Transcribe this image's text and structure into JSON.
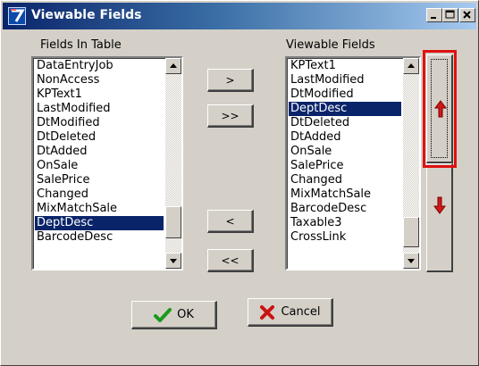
{
  "window": {
    "title": "Viewable Fields",
    "controls": [
      "minimize",
      "maximize",
      "close"
    ]
  },
  "left_panel": {
    "label": "Fields In Table",
    "items": [
      "DataEntryJob",
      "NonAccess",
      "KPText1",
      "LastModified",
      "DtModified",
      "DtDeleted",
      "DtAdded",
      "OnSale",
      "SalePrice",
      "Changed",
      "MixMatchSale",
      "DeptDesc",
      "BarcodeDesc"
    ],
    "selected": "DeptDesc"
  },
  "right_panel": {
    "label": "Viewable Fields",
    "items": [
      "KPText1",
      "LastModified",
      "DtModified",
      "DeptDesc",
      "DtDeleted",
      "DtAdded",
      "OnSale",
      "SalePrice",
      "Changed",
      "MixMatchSale",
      "BarcodeDesc",
      "Taxable3",
      "CrossLink"
    ],
    "selected": "DeptDesc"
  },
  "transfer_buttons": {
    "add": ">",
    "add_all": ">>",
    "remove": "<",
    "remove_all": "<<"
  },
  "order_buttons": {
    "up_icon": "red-up-arrow-icon",
    "down_icon": "red-down-arrow-icon",
    "highlighted": "move-up-button"
  },
  "footer_buttons": {
    "ok": "OK",
    "cancel": "Cancel"
  },
  "colors": {
    "dialog_bg": "#d4d0c8",
    "title_bar": "#0a246a",
    "selection": "#0a246a",
    "arrow_red": "#d01818",
    "ok_check": "#1a9a1a",
    "cancel_x": "#cc1111",
    "highlight_border": "#e01010"
  }
}
